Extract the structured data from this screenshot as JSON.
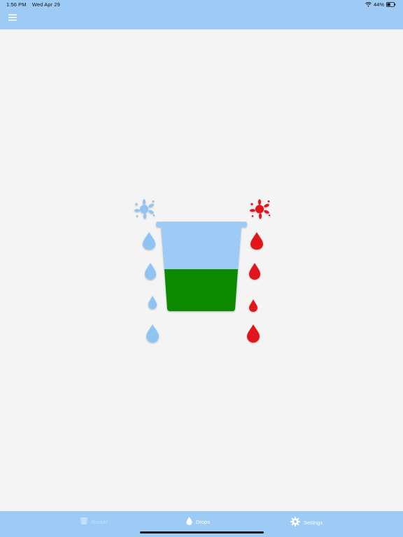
{
  "status_bar": {
    "time": "1:56 PM",
    "date": "Wed Apr 29",
    "battery": "44%",
    "icons": [
      "wifi-icon",
      "battery-icon"
    ]
  },
  "header": {
    "menu_icon": "hamburger-menu-icon"
  },
  "illustration": {
    "cup_fill_level": 0.45,
    "colors": {
      "cup": "#9dcbf5",
      "liquid": "#0a8a00",
      "left_drops": "#8ec3f2",
      "right_drops": "#e0171b"
    },
    "left_drops": 4,
    "right_drops": 4
  },
  "tab_bar": {
    "tabs": [
      {
        "label": "Bucket",
        "icon": "bucket-icon",
        "active": true
      },
      {
        "label": "Drops",
        "icon": "drop-icon",
        "active": false
      },
      {
        "label": "Settings",
        "icon": "gear-icon",
        "active": false
      }
    ]
  },
  "colors": {
    "bar_background": "#9dcbf5",
    "page_background": "#f4f4f4"
  }
}
